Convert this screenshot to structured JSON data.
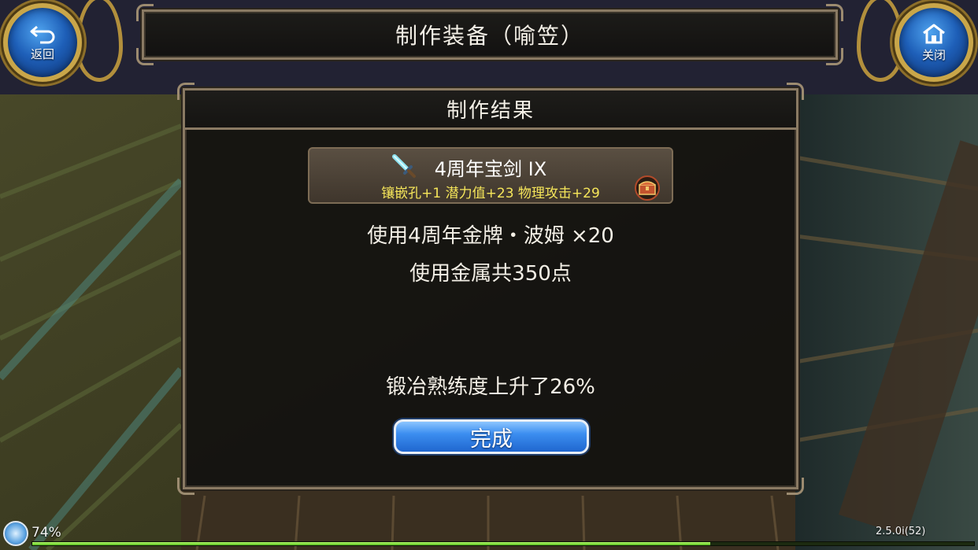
{
  "header": {
    "title": "制作装备（喻笠）"
  },
  "nav": {
    "back_label": "返回",
    "close_label": "关闭"
  },
  "panel": {
    "title": "制作结果",
    "item": {
      "name": "4周年宝剑 IX",
      "stats": "镶嵌孔+1 潜力值+23 物理攻击+29",
      "name_color": "#ffffff",
      "stats_color": "#f6e65a"
    },
    "use_medal": "使用4周年金牌・波姆 ×20",
    "use_metal": "使用金属共350点",
    "proficiency": "锻冶熟练度上升了26%",
    "done_label": "完成"
  },
  "status": {
    "battery": "74%",
    "version": "2.5.0i(52)",
    "exp_progress": 0.72
  },
  "colors": {
    "accent_blue": "#3c8ef0",
    "frame": "#8a7a63",
    "gold": "#c9a649"
  }
}
